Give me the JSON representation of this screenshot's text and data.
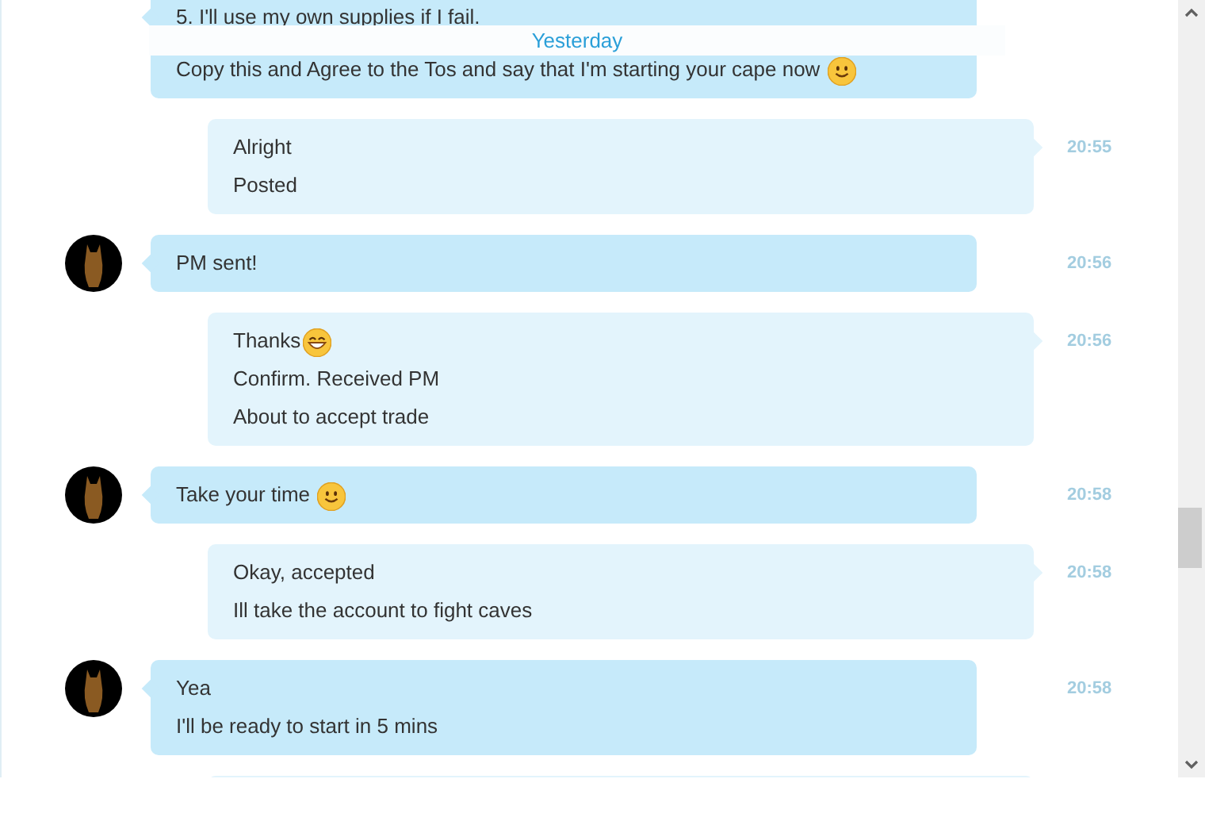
{
  "date_divider": "Yesterday",
  "messages": [
    {
      "kind": "incoming",
      "avatar": false,
      "lines": [
        {
          "kind": "plain",
          "text": "5. I'll use my own supplies if I fail."
        },
        {
          "kind": "smile",
          "text": "Copy this and Agree to the Tos and say that I'm starting your cape now "
        }
      ]
    },
    {
      "kind": "outgoing",
      "avatar": false,
      "time": "20:55",
      "lines": [
        {
          "kind": "plain",
          "text": "Alright"
        },
        {
          "kind": "plain",
          "text": "Posted"
        }
      ]
    },
    {
      "kind": "incoming",
      "avatar": true,
      "time": "20:56",
      "lines": [
        {
          "kind": "plain",
          "text": "PM sent!"
        }
      ]
    },
    {
      "kind": "outgoing",
      "avatar": false,
      "time": "20:56",
      "lines": [
        {
          "kind": "grin",
          "text": "Thanks"
        },
        {
          "kind": "plain",
          "text": "Confirm. Received PM"
        },
        {
          "kind": "plain",
          "text": "About to accept trade"
        }
      ]
    },
    {
      "kind": "incoming",
      "avatar": true,
      "time": "20:58",
      "lines": [
        {
          "kind": "smile",
          "text": "Take your time "
        }
      ]
    },
    {
      "kind": "outgoing",
      "avatar": false,
      "time": "20:58",
      "lines": [
        {
          "kind": "plain",
          "text": "Okay, accepted"
        },
        {
          "kind": "plain",
          "text": "Ill take the account to fight caves"
        }
      ]
    },
    {
      "kind": "incoming",
      "avatar": true,
      "time": "20:58",
      "lines": [
        {
          "kind": "plain",
          "text": "Yea"
        },
        {
          "kind": "plain",
          "text": "I'll be ready to start in 5 mins"
        }
      ]
    },
    {
      "kind": "outgoing",
      "avatar": false
    }
  ]
}
